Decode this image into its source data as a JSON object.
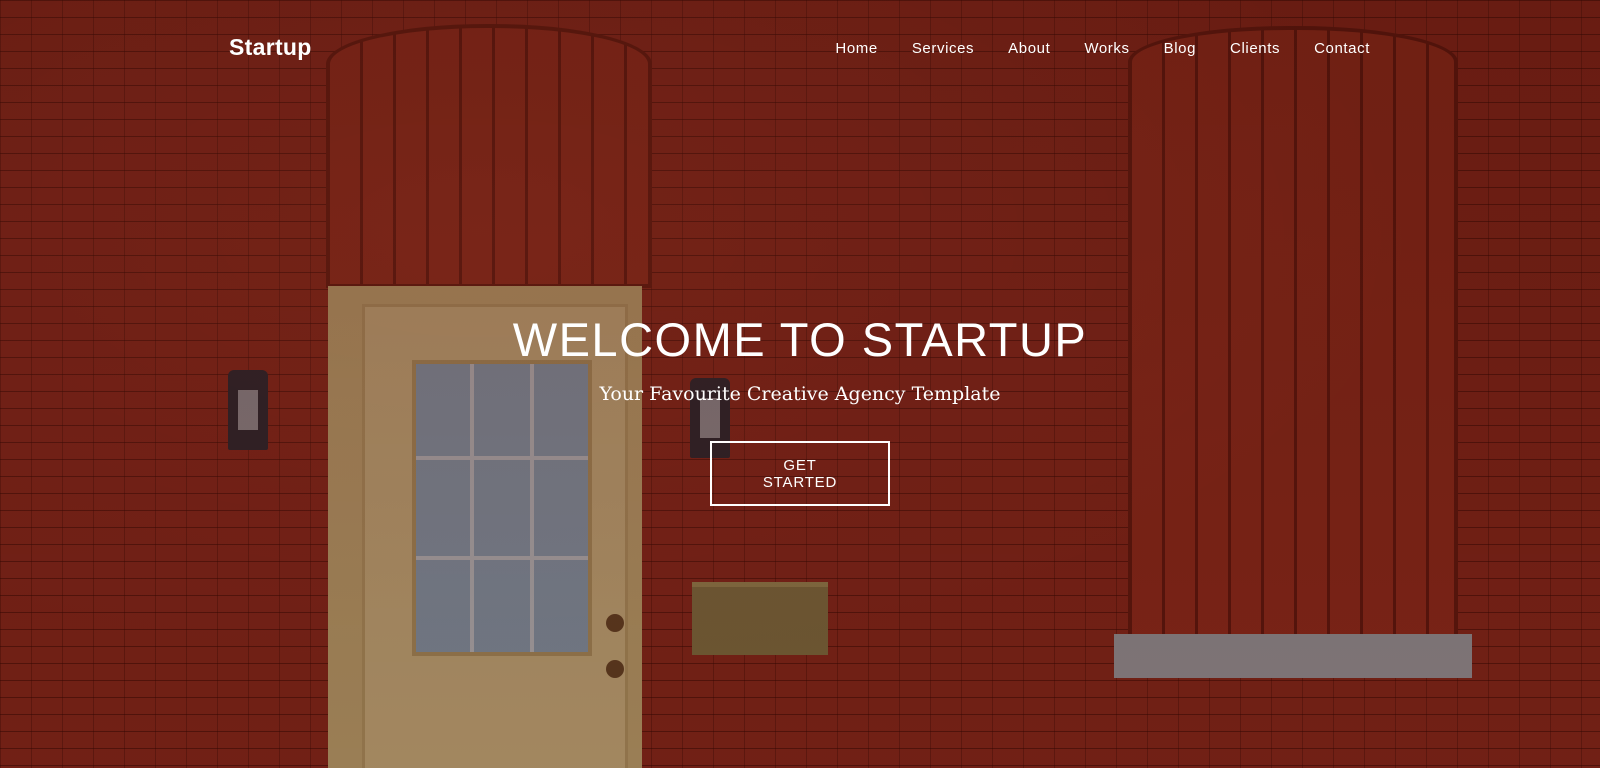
{
  "brand": "Startup",
  "nav": {
    "items": [
      {
        "label": "Home"
      },
      {
        "label": "Services"
      },
      {
        "label": "About"
      },
      {
        "label": "Works"
      },
      {
        "label": "Blog"
      },
      {
        "label": "Clients"
      },
      {
        "label": "Contact"
      }
    ]
  },
  "hero": {
    "title": "WELCOME TO STARTUP",
    "subtitle": "Your Favourite Creative Agency Template",
    "cta_label": "GET STARTED"
  },
  "colors": {
    "text": "#ffffff",
    "background_brick": "#922c1f"
  }
}
